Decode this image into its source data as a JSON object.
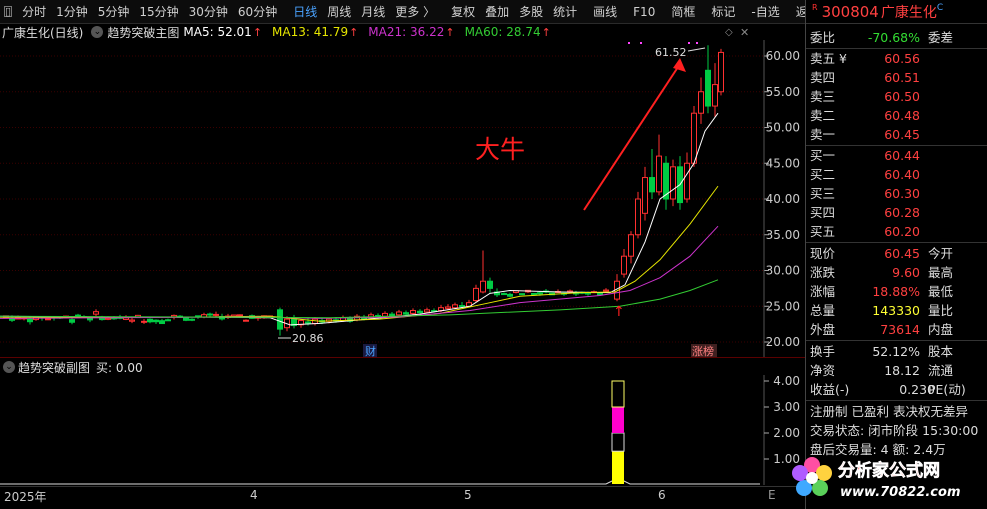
{
  "toolbar": {
    "items": [
      "分时",
      "1分钟",
      "5分钟",
      "15分钟",
      "30分钟",
      "60分钟",
      "日线",
      "周线",
      "月线",
      "更多 〉",
      "复权",
      "叠加",
      "多股",
      "统计",
      "画线",
      "F10",
      "简框",
      "标记",
      "-自选",
      "返回"
    ],
    "active_index": 6
  },
  "header": {
    "stock": "广康生化(日线)",
    "indicator": "趋势突破主图",
    "ma5": "MA5: 52.01",
    "ma13": "MA13: 41.79",
    "ma21": "MA21: 36.22",
    "ma60": "MA60: 28.74",
    "up_arrow": "↑"
  },
  "main_chart": {
    "y_ticks": [
      "60.00",
      "55.00",
      "50.00",
      "45.00",
      "40.00",
      "35.00",
      "30.00",
      "25.00",
      "20.00"
    ],
    "high_label": "61.52",
    "low_label": "20.86",
    "annotation": "大牛",
    "marker_cai": "财",
    "marker_zhangbang": "涨榜"
  },
  "sub_chart": {
    "title": "趋势突破副图",
    "value": "买: 0.00",
    "y_ticks": [
      "4.00",
      "3.00",
      "2.00",
      "1.00"
    ]
  },
  "time_axis": {
    "labels": [
      "2025年",
      "4",
      "5",
      "6"
    ]
  },
  "quote": {
    "r_badge": "R",
    "code": "300804",
    "name": "广康生化",
    "c_badge": "C",
    "weibi_label": "委比",
    "weibi_value": "-70.68%",
    "weicha_label": "委差",
    "asks": [
      {
        "label": "卖五 ¥",
        "price": "60.56"
      },
      {
        "label": "卖四",
        "price": "60.51"
      },
      {
        "label": "卖三",
        "price": "60.50"
      },
      {
        "label": "卖二",
        "price": "60.48"
      },
      {
        "label": "卖一",
        "price": "60.45"
      }
    ],
    "bids": [
      {
        "label": "买一",
        "price": "60.44"
      },
      {
        "label": "买二",
        "price": "60.40"
      },
      {
        "label": "买三",
        "price": "60.30"
      },
      {
        "label": "买四",
        "price": "60.28"
      },
      {
        "label": "买五",
        "price": "60.20"
      }
    ],
    "stats": [
      {
        "label": "现价",
        "value": "60.45",
        "label2": "今开"
      },
      {
        "label": "涨跌",
        "value": "9.60",
        "label2": "最高"
      },
      {
        "label": "涨幅",
        "value": "18.88%",
        "label2": "最低"
      },
      {
        "label": "总量",
        "value": "143330",
        "label2": "量比"
      },
      {
        "label": "外盘",
        "value": "73614",
        "label2": "内盘"
      }
    ],
    "stats2": [
      {
        "label": "换手",
        "value": "52.12%",
        "label2": "股本"
      },
      {
        "label": "净资",
        "value": "18.12",
        "label2": "流通"
      },
      {
        "label": "收益(-)",
        "value": "0.230",
        "label2": "PE(动)"
      }
    ],
    "tags": "注册制 已盈利 表决权无差异",
    "trade_status": "交易状态: 闭市阶段 15:30:00",
    "after_hours": "盘后交易量: 4  额: 2.4万"
  },
  "watermark": {
    "line1": "分析家公式网",
    "line2": "www.70822.com"
  },
  "colors": {
    "up": "#ff3030",
    "down": "#00cc44",
    "ma5": "#ffffff",
    "ma13": "#e6e600",
    "ma21": "#cc33cc",
    "ma60": "#33cc33"
  }
}
